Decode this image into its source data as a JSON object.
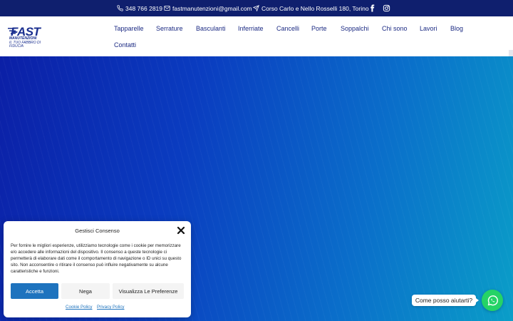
{
  "topbar": {
    "phone": "348 766 2819",
    "email": "fastmanutenzioni@gmail.com",
    "address": "Corso Carlo e Nello Rosselli 180, Torino",
    "social": [
      "facebook-icon",
      "instagram-icon"
    ]
  },
  "logo": {
    "name": "FAST",
    "subtitle": "MANUTENZIONI",
    "tagline": "IL TUO FABBRO DI FIDUCIA"
  },
  "nav": {
    "items": [
      {
        "label": "Tapparelle"
      },
      {
        "label": "Serrature"
      },
      {
        "label": "Basculanti"
      },
      {
        "label": "Inferriate"
      },
      {
        "label": "Cancelli"
      },
      {
        "label": "Porte"
      },
      {
        "label": "Soppalchi"
      },
      {
        "label": "Chi sono"
      },
      {
        "label": "Lavori"
      },
      {
        "label": "Blog"
      },
      {
        "label": "Contatti"
      }
    ]
  },
  "consent": {
    "title": "Gestisci Consenso",
    "body": "Per fornire le migliori esperienze, utilizziamo tecnologie come i cookie per memorizzare e/o accedere alle informazioni del dispositivo. Il consenso a queste tecnologie ci permetterà di elaborare dati come il comportamento di navigazione o ID unici su questo sito. Non acconsentire o ritirare il consenso può influire negativamente su alcune caratteristiche e funzioni.",
    "accept_label": "Accetta",
    "deny_label": "Nega",
    "preferences_label": "Visualizza Le Preferenze",
    "cookie_policy_label": "Cookie Policy",
    "privacy_policy_label": "Privacy Policy"
  },
  "chat": {
    "prompt": "Come posso aiutarti?"
  },
  "colors": {
    "topbar_bg": "#0f1f6e",
    "brand_blue": "#1a2f8f",
    "hero_start": "#0b1fa6",
    "hero_end": "#0a9ec8",
    "accept_button": "#1e73be",
    "whatsapp_green": "#25d366"
  }
}
